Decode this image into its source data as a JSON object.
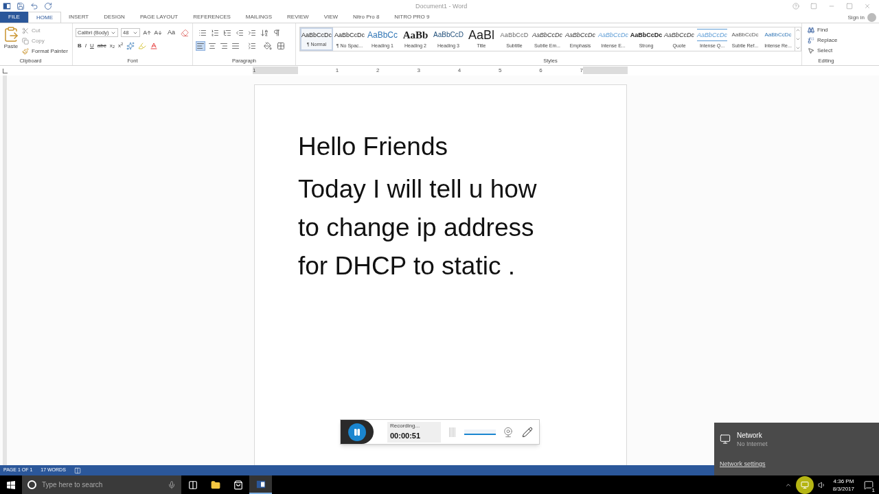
{
  "window": {
    "title": "Document1 - Word",
    "sign_in": "Sign in"
  },
  "tabs": [
    {
      "label": "FILE",
      "kind": "file",
      "selected": false
    },
    {
      "label": "HOME",
      "kind": "tab",
      "selected": true
    },
    {
      "label": "INSERT",
      "kind": "tab",
      "selected": false
    },
    {
      "label": "DESIGN",
      "kind": "tab",
      "selected": false
    },
    {
      "label": "PAGE LAYOUT",
      "kind": "tab",
      "selected": false
    },
    {
      "label": "REFERENCES",
      "kind": "tab",
      "selected": false
    },
    {
      "label": "MAILINGS",
      "kind": "tab",
      "selected": false
    },
    {
      "label": "REVIEW",
      "kind": "tab",
      "selected": false
    },
    {
      "label": "VIEW",
      "kind": "tab",
      "selected": false
    },
    {
      "label": "Nitro Pro 8",
      "kind": "tab",
      "selected": false
    },
    {
      "label": "NITRO PRO 9",
      "kind": "tab",
      "selected": false
    }
  ],
  "clipboard": {
    "label": "Clipboard",
    "paste": "Paste",
    "cut": "Cut",
    "copy": "Copy",
    "format_painter": "Format Painter"
  },
  "font": {
    "label": "Font",
    "name": "Calibri (Body)",
    "size": "48",
    "case_button": "Aa",
    "format_buttons": [
      "B",
      "I",
      "U",
      "abc",
      "x$_{2}$",
      "x$^{2}$"
    ]
  },
  "paragraph": {
    "label": "Paragraph",
    "align_buttons": [
      {
        "kind": "left",
        "selected": true
      },
      {
        "kind": "center",
        "selected": false
      },
      {
        "kind": "right",
        "selected": false
      },
      {
        "kind": "justify",
        "selected": false
      }
    ]
  },
  "styles": {
    "label": "Styles",
    "items": [
      {
        "preview": "AaBbCcDc",
        "label": "¶ Normal",
        "kind": "normal",
        "selected": true
      },
      {
        "preview": "AaBbCcDc",
        "label": "¶ No Spac...",
        "kind": "normal",
        "selected": false
      },
      {
        "preview": "AaBbCc",
        "label": "Heading 1",
        "kind": "heading1",
        "selected": false
      },
      {
        "preview": "AaBb",
        "label": "Heading 2",
        "kind": "heading2",
        "selected": false
      },
      {
        "preview": "AaBbCcD",
        "label": "Heading 3",
        "kind": "heading3",
        "selected": false
      },
      {
        "preview": "AaBl",
        "label": "Title",
        "kind": "title",
        "selected": false
      },
      {
        "preview": "AaBbCcD",
        "label": "Subtitle",
        "kind": "subtitle",
        "selected": false
      },
      {
        "preview": "AaBbCcDc",
        "label": "Subtle Em...",
        "kind": "italic",
        "selected": false
      },
      {
        "preview": "AaBbCcDc",
        "label": "Emphasis",
        "kind": "italic",
        "selected": false
      },
      {
        "preview": "AaBbCcDc",
        "label": "Intense E...",
        "kind": "accent-italic",
        "selected": false
      },
      {
        "preview": "AaBbCcDc",
        "label": "Strong",
        "kind": "bold",
        "selected": false
      },
      {
        "preview": "AaBbCcDc",
        "label": "Quote",
        "kind": "italic",
        "selected": false
      },
      {
        "preview": "AaBbCcDc",
        "label": "Intense Q...",
        "kind": "accent-quote",
        "selected": false
      },
      {
        "preview": "AaBbCcDc",
        "label": "Subtle Ref...",
        "kind": "smallcaps",
        "selected": false
      },
      {
        "preview": "AaBbCcDc",
        "label": "Intense Re...",
        "kind": "accent-smallcaps",
        "selected": false
      }
    ]
  },
  "editing": {
    "label": "Editing",
    "find": "Find",
    "replace": "Replace",
    "select": "Select"
  },
  "ruler": {
    "numbers": [
      "1",
      "1",
      "2",
      "3",
      "4",
      "5",
      "6",
      "7"
    ]
  },
  "document": {
    "heading": "Hello Friends",
    "lines": [
      "Today I will tell u how",
      "to change ip address",
      "for DHCP to static ."
    ]
  },
  "status_bar": {
    "page": "PAGE 1 OF 1",
    "words": "17 WORDS"
  },
  "recorder": {
    "status": "Recording...",
    "time": "00:00:51",
    "volume": {
      "level": 1
    }
  },
  "network_flyout": {
    "title": "Network",
    "status": "No Internet",
    "link": "Network settings"
  },
  "taskbar": {
    "search_placeholder": "Type here to search",
    "apps": [
      {
        "kind": "task-view",
        "selected": false
      },
      {
        "kind": "explorer",
        "selected": false
      },
      {
        "kind": "store",
        "selected": false
      },
      {
        "kind": "word",
        "selected": true
      }
    ],
    "time": "4:36 PM",
    "date": "8/3/2017",
    "notifications": "1"
  }
}
